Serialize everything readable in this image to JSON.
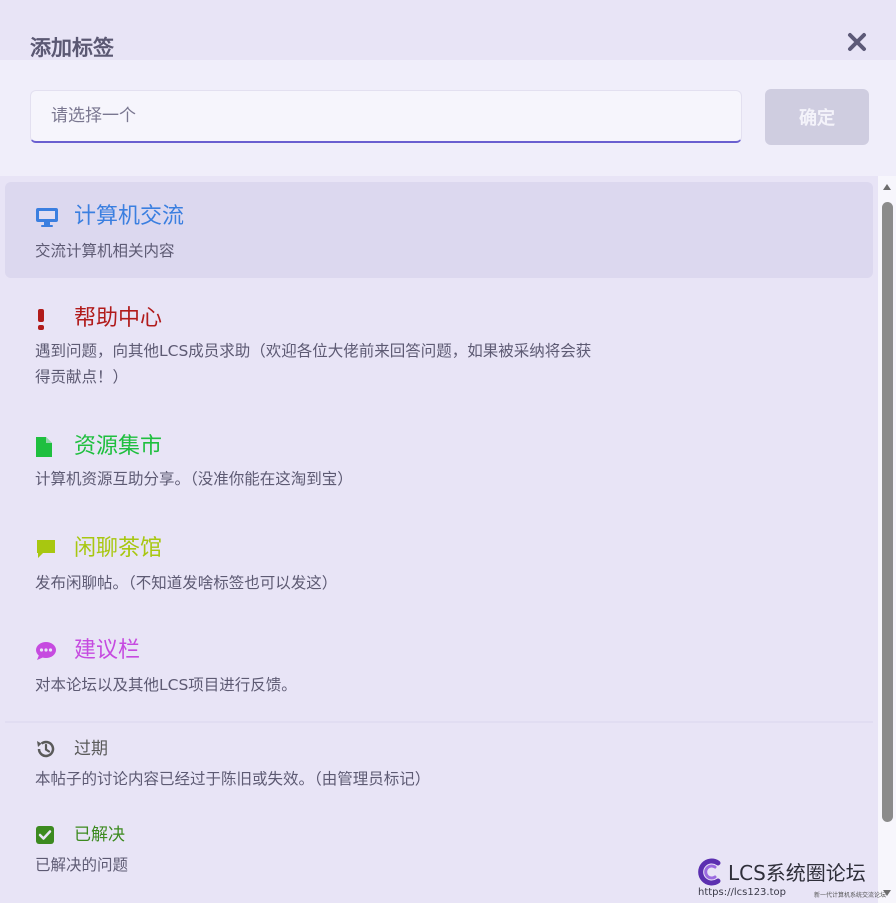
{
  "dialog": {
    "title": "添加标签",
    "search": {
      "placeholder": "请选择一个",
      "value": ""
    },
    "confirm_label": "确定"
  },
  "tags": [
    {
      "name": "计算机交流",
      "description": "交流计算机相关内容",
      "icon": "desktop-icon",
      "color": "#3b7fe0",
      "active": true
    },
    {
      "name": "帮助中心",
      "description": "遇到问题，向其他LCS成员求助（欢迎各位大佬前来回答问题，如果被采纳将会获得贡献点！）",
      "icon": "exclamation-icon",
      "color": "#b11b1b"
    },
    {
      "name": "资源集市",
      "description": "计算机资源互助分享。（没准你能在这淘到宝）",
      "icon": "file-icon",
      "color": "#1fbf3f"
    },
    {
      "name": "闲聊茶馆",
      "description": "发布闲聊帖。（不知道发啥标签也可以发这）",
      "icon": "comment-icon",
      "color": "#a8c710"
    },
    {
      "name": "建议栏",
      "description": "对本论坛以及其他LCS项目进行反馈。",
      "icon": "comment-dots-icon",
      "color": "#c64be0"
    },
    {
      "name": "过期",
      "description": "本帖子的讨论内容已经过于陈旧或失效。（由管理员标记）",
      "icon": "history-icon",
      "color": "#5a5a5a"
    },
    {
      "name": "已解决",
      "description": "已解决的问题",
      "icon": "check-square-icon",
      "color": "#3c8a1f"
    }
  ],
  "watermark": {
    "title": "LCS系统圈论坛",
    "url": "https://lcs123.top",
    "slogan": "新一代计算机系统交流论坛"
  }
}
